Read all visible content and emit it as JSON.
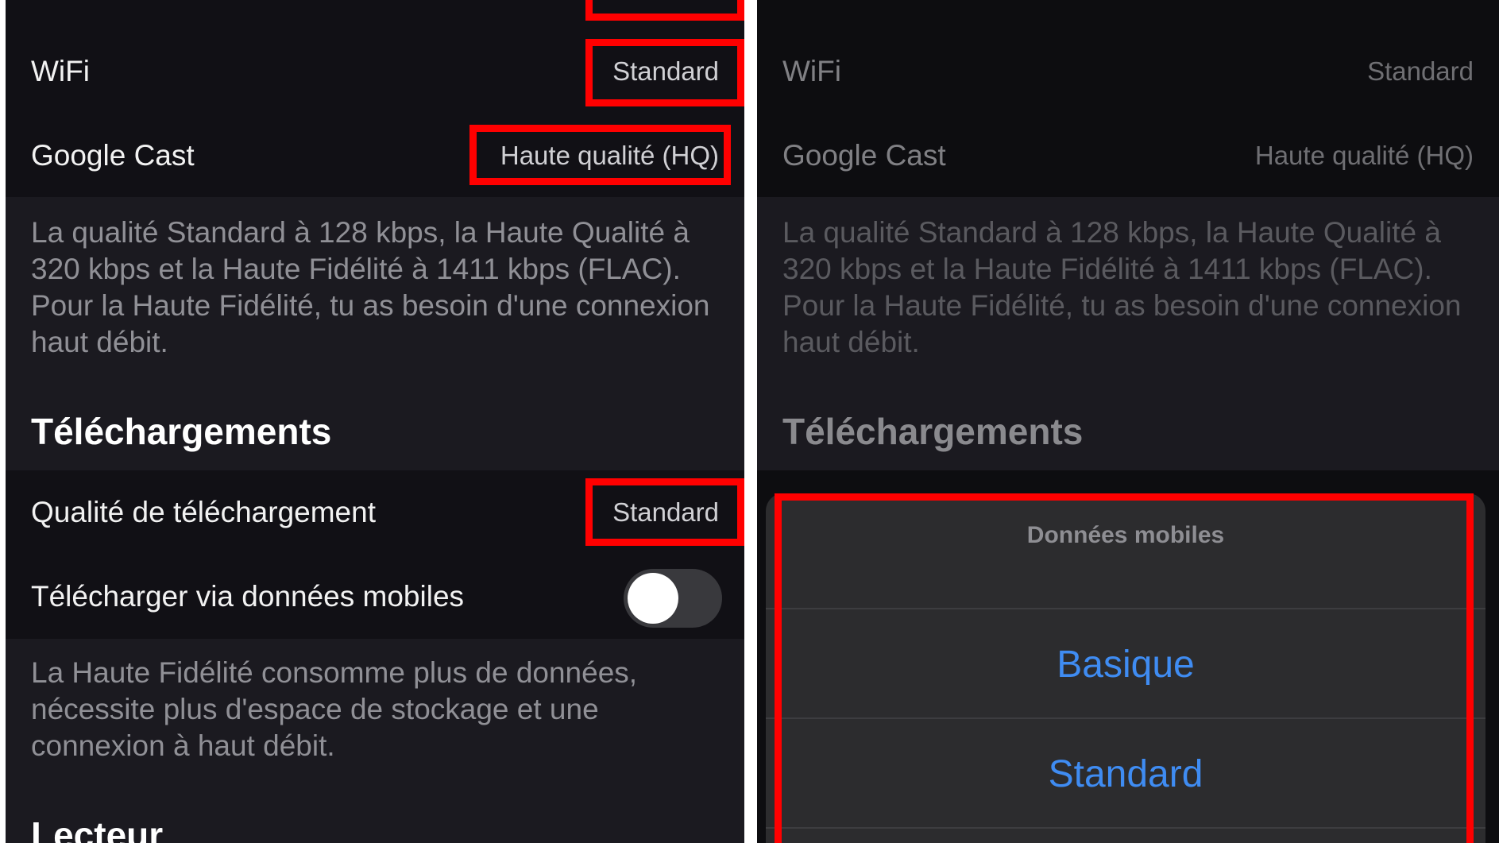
{
  "left": {
    "rows": [
      {
        "label": "WiFi",
        "value": "Standard"
      },
      {
        "label": "Google Cast",
        "value": "Haute qualité (HQ)"
      }
    ],
    "streaming_description": "La qualité Standard à 128 kbps, la Haute Qualité à 320 kbps et la Haute Fidélité à 1411 kbps (FLAC). Pour la Haute Fidélité, tu as besoin d'une connexion haut débit.",
    "downloads_title": "Téléchargements",
    "download_quality": {
      "label": "Qualité de téléchargement",
      "value": "Standard"
    },
    "download_mobile": {
      "label": "Télécharger via données mobiles",
      "enabled": false
    },
    "downloads_description": "La Haute Fidélité consomme plus de données, nécessite plus d'espace de stockage et une connexion à haut débit.",
    "player_title": "Lecteur"
  },
  "right": {
    "rows": [
      {
        "label": "WiFi",
        "value": "Standard"
      },
      {
        "label": "Google Cast",
        "value": "Haute qualité (HQ)"
      }
    ],
    "streaming_description": "La qualité Standard à 128 kbps, la Haute Qualité à 320 kbps et la Haute Fidélité à 1411 kbps (FLAC). Pour la Haute Fidélité, tu as besoin d'une connexion haut débit.",
    "downloads_title": "Téléchargements",
    "action_sheet": {
      "title": "Données mobiles",
      "options": [
        "Basique",
        "Standard"
      ]
    }
  },
  "colors": {
    "highlight": "#ff0000",
    "option_blue": "#3f8cf2",
    "background": "#1b1a20",
    "cell_background": "#111015"
  }
}
